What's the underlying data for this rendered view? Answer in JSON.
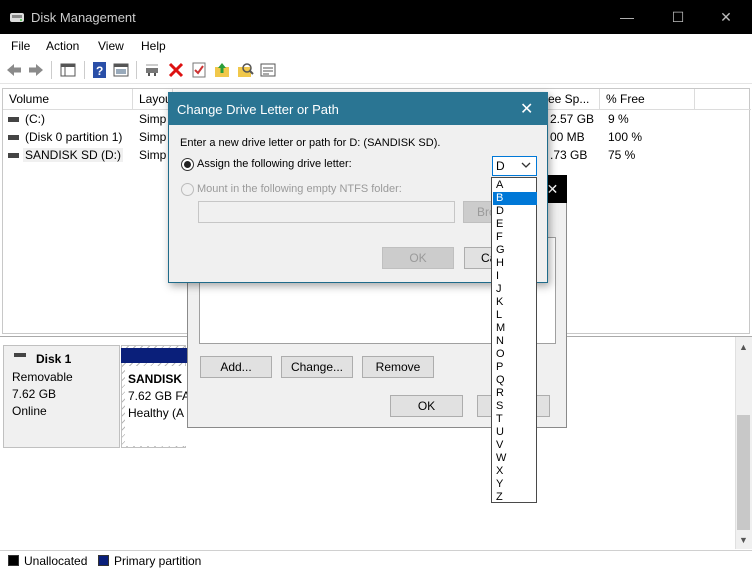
{
  "window": {
    "title": "Disk Management",
    "controls": {
      "minimize": "—",
      "maximize": "☐",
      "close": "✕"
    }
  },
  "menu": [
    "File",
    "Action",
    "View",
    "Help"
  ],
  "toolbar": {
    "icons": [
      "back-arrow-icon",
      "forward-arrow-icon",
      "console-tree-icon",
      "help-icon",
      "properties-icon",
      "connect-icon",
      "delete-icon",
      "checklist-icon",
      "up-folder-icon",
      "search-folder-icon",
      "settings-panel-icon"
    ]
  },
  "volumes": {
    "columns": [
      "Volume",
      "Layou",
      "ree Sp...",
      "% Free"
    ],
    "rows": [
      {
        "volume": "(C:)",
        "layout": "Simp",
        "free": "2.57 GB",
        "pct": "9 %"
      },
      {
        "volume": "(Disk 0 partition 1)",
        "layout": "Simp",
        "free": "00 MB",
        "pct": "100 %"
      },
      {
        "volume": "SANDISK SD (D:)",
        "layout": "Simp",
        "free": ".73 GB",
        "pct": "75 %"
      }
    ]
  },
  "disk": {
    "name": "Disk 1",
    "type": "Removable",
    "size": "7.62 GB",
    "status": "Online",
    "partition": {
      "name": "SANDISK",
      "size": "7.62 GB FA",
      "health": "Healthy (A"
    }
  },
  "legend": [
    {
      "label": "Unallocated",
      "color": "#000000"
    },
    {
      "label": "Primary partition",
      "color": "#0a1f7a"
    }
  ],
  "bg_dialog": {
    "close": "✕",
    "add": "Add...",
    "change": "Change...",
    "remove": "Remove",
    "ok": "OK"
  },
  "dialog": {
    "title": "Change Drive Letter or Path",
    "close": "✕",
    "instruction": "Enter a new drive letter or path for D: (SANDISK SD).",
    "option_assign": "Assign the following drive letter:",
    "option_mount": "Mount in the following empty NTFS folder:",
    "browse": "Bro",
    "ok": "OK",
    "cancel": "Ca",
    "selected_letter": "D",
    "letters": [
      "A",
      "B",
      "D",
      "E",
      "F",
      "G",
      "H",
      "I",
      "J",
      "K",
      "L",
      "M",
      "N",
      "O",
      "P",
      "Q",
      "R",
      "S",
      "T",
      "U",
      "V",
      "W",
      "X",
      "Y",
      "Z"
    ],
    "highlighted": "B"
  },
  "colors": {
    "dialog_title": "#2a7593",
    "accent": "#0078d7",
    "primary_partition": "#0a1f7a"
  }
}
